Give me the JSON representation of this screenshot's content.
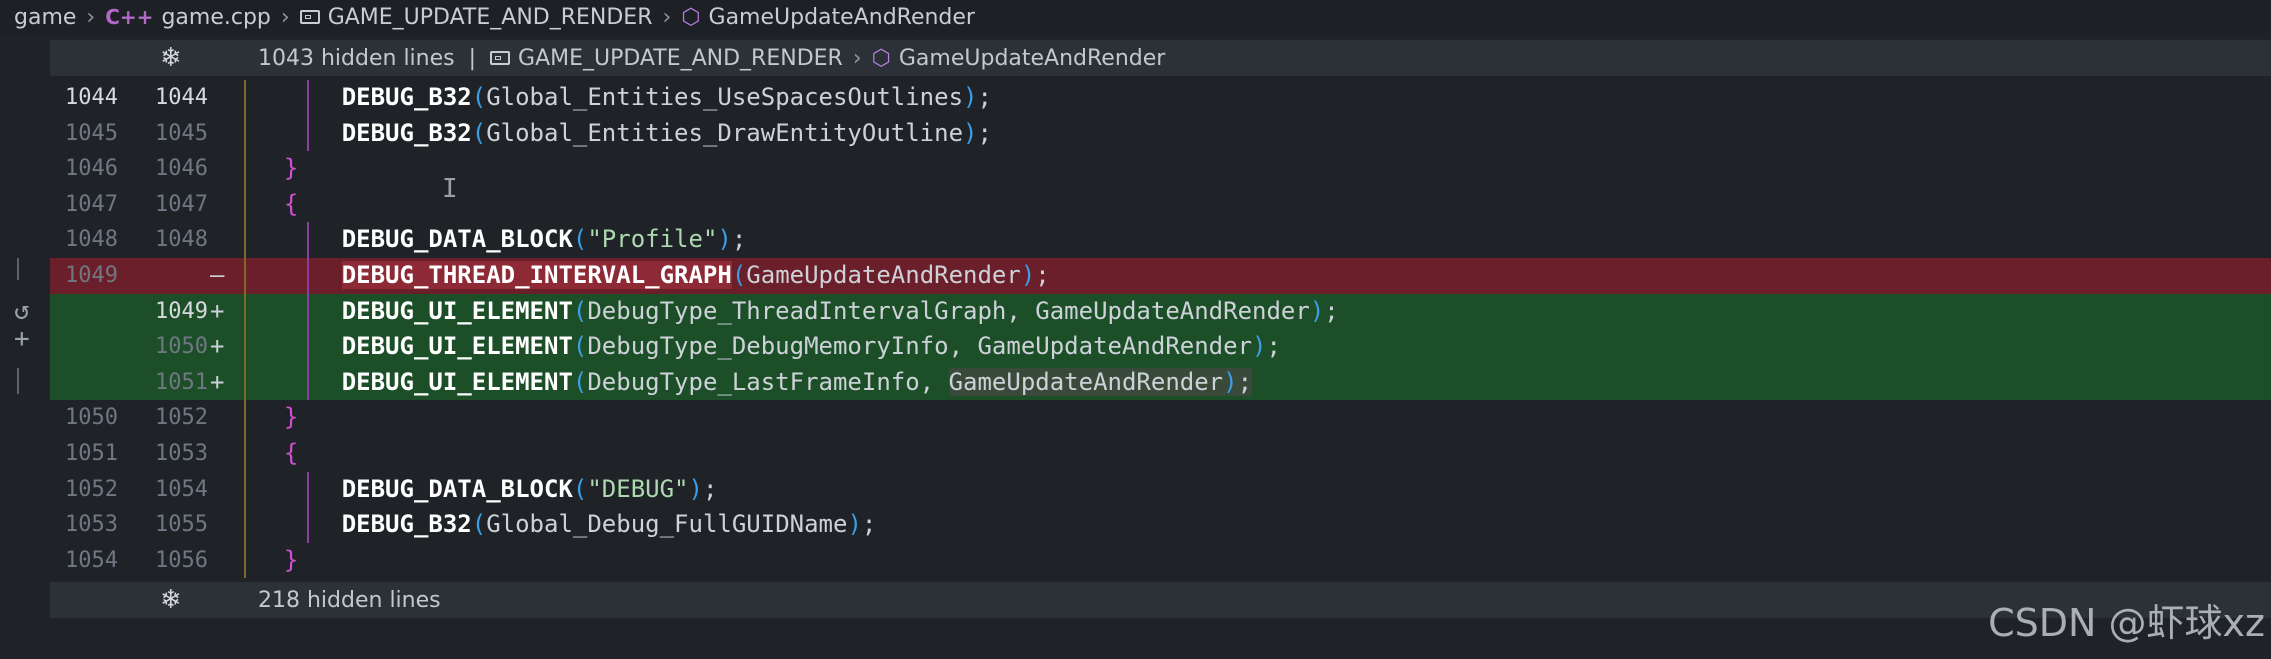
{
  "breadcrumb": {
    "folder": "game",
    "file_icon": "C++",
    "file": "game.cpp",
    "namespace": "GAME_UPDATE_AND_RENDER",
    "symbol": "GameUpdateAndRender"
  },
  "top_hidden": {
    "label": "1043 hidden lines",
    "divider": "|",
    "namespace": "GAME_UPDATE_AND_RENDER",
    "symbol": "GameUpdateAndRender"
  },
  "bottom_hidden": {
    "label": "218 hidden lines"
  },
  "gutter_icons": [
    "revert-icon",
    "add-icon"
  ],
  "lines": [
    {
      "old": "1044",
      "new": "1044",
      "marker": "",
      "kind": "ctx",
      "cur": true,
      "tokens": [
        [
          "      ",
          "ident"
        ],
        [
          "DEBUG_B32",
          "fn"
        ],
        [
          "(",
          "paren"
        ],
        [
          "Global_Entities_UseSpacesOutlines",
          "ident"
        ],
        [
          ")",
          "paren"
        ],
        [
          ";",
          "ident"
        ]
      ]
    },
    {
      "old": "1045",
      "new": "1045",
      "marker": "",
      "kind": "ctx",
      "tokens": [
        [
          "      ",
          "ident"
        ],
        [
          "DEBUG_B32",
          "fn"
        ],
        [
          "(",
          "paren"
        ],
        [
          "Global_Entities_DrawEntityOutline",
          "ident"
        ],
        [
          ")",
          "paren"
        ],
        [
          ";",
          "ident"
        ]
      ]
    },
    {
      "old": "1046",
      "new": "1046",
      "marker": "",
      "kind": "ctx",
      "tokens": [
        [
          "  ",
          "ident"
        ],
        [
          "}",
          "brace"
        ]
      ]
    },
    {
      "old": "1047",
      "new": "1047",
      "marker": "",
      "kind": "ctx",
      "tokens": [
        [
          "  ",
          "ident"
        ],
        [
          "{",
          "brace"
        ]
      ]
    },
    {
      "old": "1048",
      "new": "1048",
      "marker": "",
      "kind": "ctx",
      "tokens": [
        [
          "      ",
          "ident"
        ],
        [
          "DEBUG_DATA_BLOCK",
          "fn"
        ],
        [
          "(",
          "paren"
        ],
        [
          "\"Profile\"",
          "str"
        ],
        [
          ")",
          "paren"
        ],
        [
          ";",
          "ident"
        ]
      ]
    },
    {
      "old": "1049",
      "new": "",
      "marker": "—",
      "kind": "removed",
      "tokens": [
        [
          "      ",
          "ident"
        ],
        [
          "DEBUG_THREAD_INTERVAL_GRAPH",
          "fn hl-old"
        ],
        [
          "(",
          "paren"
        ],
        [
          "GameUpdateAndRender",
          "ident"
        ],
        [
          ")",
          "paren"
        ],
        [
          ";",
          "ident"
        ]
      ]
    },
    {
      "old": "",
      "new": "1049",
      "marker": "+",
      "kind": "added",
      "cur": true,
      "tokens": [
        [
          "      ",
          "ident"
        ],
        [
          "DEBUG_UI_ELEMENT",
          "fn"
        ],
        [
          "(",
          "paren"
        ],
        [
          "DebugType_ThreadIntervalGraph, ",
          "ident"
        ],
        [
          "GameUpdateAndRender",
          "ident"
        ],
        [
          ")",
          "paren"
        ],
        [
          ";",
          "ident"
        ]
      ]
    },
    {
      "old": "",
      "new": "1050",
      "marker": "+",
      "kind": "added",
      "tokens": [
        [
          "      ",
          "ident"
        ],
        [
          "DEBUG_UI_ELEMENT",
          "fn"
        ],
        [
          "(",
          "paren"
        ],
        [
          "DebugType_DebugMemoryInfo, ",
          "ident"
        ],
        [
          "GameUpdateAndRender",
          "ident"
        ],
        [
          ")",
          "paren"
        ],
        [
          ";",
          "ident"
        ]
      ]
    },
    {
      "old": "",
      "new": "1051",
      "marker": "+",
      "kind": "added",
      "tokens": [
        [
          "      ",
          "ident"
        ],
        [
          "DEBUG_UI_ELEMENT",
          "fn"
        ],
        [
          "(",
          "paren"
        ],
        [
          "DebugType_LastFrameInfo, ",
          "ident"
        ],
        [
          "GameUpdateAndRender",
          "ident hl-tail"
        ],
        [
          ")",
          "paren hl-tail"
        ],
        [
          ";",
          "ident hl-tail"
        ]
      ]
    },
    {
      "old": "1050",
      "new": "1052",
      "marker": "",
      "kind": "ctx",
      "tokens": [
        [
          "  ",
          "ident"
        ],
        [
          "}",
          "brace"
        ]
      ]
    },
    {
      "old": "1051",
      "new": "1053",
      "marker": "",
      "kind": "ctx",
      "tokens": [
        [
          "  ",
          "ident"
        ],
        [
          "{",
          "brace"
        ]
      ]
    },
    {
      "old": "1052",
      "new": "1054",
      "marker": "",
      "kind": "ctx",
      "tokens": [
        [
          "      ",
          "ident"
        ],
        [
          "DEBUG_DATA_BLOCK",
          "fn"
        ],
        [
          "(",
          "paren"
        ],
        [
          "\"DEBUG\"",
          "str"
        ],
        [
          ")",
          "paren"
        ],
        [
          ";",
          "ident"
        ]
      ]
    },
    {
      "old": "1053",
      "new": "1055",
      "marker": "",
      "kind": "ctx",
      "tokens": [
        [
          "      ",
          "ident"
        ],
        [
          "DEBUG_B32",
          "fn"
        ],
        [
          "(",
          "paren"
        ],
        [
          "Global_Debug_FullGUIDName",
          "ident"
        ],
        [
          ")",
          "paren"
        ],
        [
          ";",
          "ident"
        ]
      ]
    },
    {
      "old": "1054",
      "new": "1056",
      "marker": "",
      "kind": "ctx",
      "tokens": [
        [
          "  ",
          "ident"
        ],
        [
          "}",
          "brace"
        ]
      ]
    }
  ],
  "watermark": "CSDN @虾球xz",
  "colors": {
    "background": "#1f2328",
    "removed_line": "#6b1f2a",
    "added_line": "#1c4f28",
    "brace": "#d14fd1",
    "paren": "#3c9ee6",
    "string": "#aed9b0"
  }
}
